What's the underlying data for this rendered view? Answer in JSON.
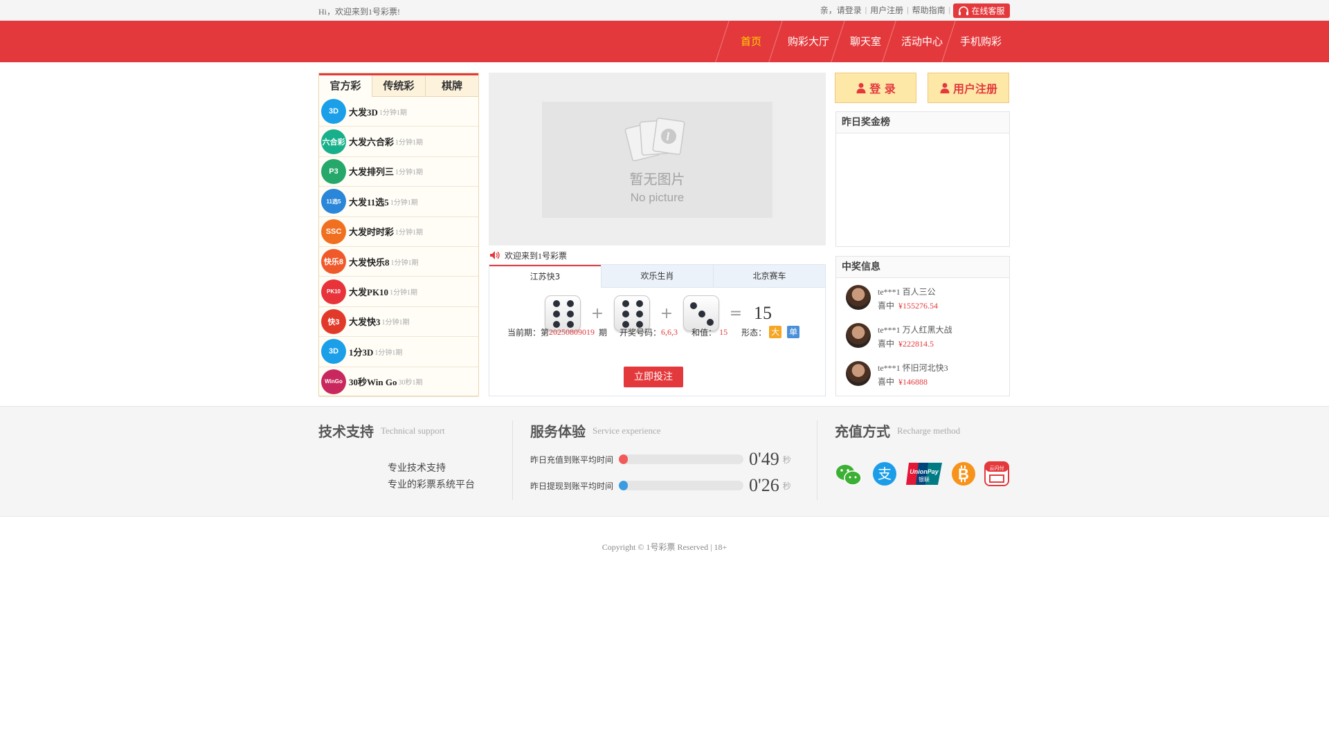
{
  "topbar": {
    "welcome": "Hi，欢迎来到1号彩票!",
    "login": "亲，请登录",
    "register": "用户注册",
    "help": "帮助指南",
    "separator": "|",
    "service": "在线客服"
  },
  "nav": {
    "items": [
      {
        "label": "首页",
        "active": true
      },
      {
        "label": "购彩大厅",
        "active": false
      },
      {
        "label": "聊天室",
        "active": false
      },
      {
        "label": "活动中心",
        "active": false
      },
      {
        "label": "手机购彩",
        "active": false
      }
    ]
  },
  "lottery": {
    "tabs": [
      "官方彩",
      "传统彩",
      "棋牌"
    ],
    "items": [
      {
        "name": "大发3D",
        "period": "1分钟1期",
        "icon_text": "3D",
        "color": "#1a9fe8"
      },
      {
        "name": "大发六合彩",
        "period": "1分钟1期",
        "icon_text": "六合彩",
        "color": "#17b08a"
      },
      {
        "name": "大发排列三",
        "period": "1分钟1期",
        "icon_text": "P3",
        "color": "#25a86a"
      },
      {
        "name": "大发11选5",
        "period": "1分钟1期",
        "icon_text": "11选5",
        "color": "#2a86d8"
      },
      {
        "name": "大发时时彩",
        "period": "1分钟1期",
        "icon_text": "SSC",
        "color": "#f07020"
      },
      {
        "name": "大发快乐8",
        "period": "1分钟1期",
        "icon_text": "快乐8",
        "color": "#f05a2a"
      },
      {
        "name": "大发PK10",
        "period": "1分钟1期",
        "icon_text": "PK10",
        "color": "#e8333a"
      },
      {
        "name": "大发快3",
        "period": "1分钟1期",
        "icon_text": "快3",
        "color": "#e23a2a"
      },
      {
        "name": "1分3D",
        "period": "1分钟1期",
        "icon_text": "3D",
        "color": "#1a9fe8"
      },
      {
        "name": "30秒Win Go",
        "period": "30秒1期",
        "icon_text": "WinGo",
        "color": "#c8285e"
      }
    ]
  },
  "banner": {
    "no_picture_cn": "暂无图片",
    "no_picture_en": "No picture"
  },
  "notice": "欢迎来到1号彩票",
  "draw": {
    "tabs": [
      {
        "label": "江苏快3",
        "active": true
      },
      {
        "label": "欢乐生肖",
        "active": false
      },
      {
        "label": "北京赛车",
        "active": false
      }
    ],
    "dice": [
      6,
      6,
      3
    ],
    "plus": "+",
    "equals": "=",
    "sum": "15",
    "period_label": "当前期：第",
    "period": "20250809019",
    "period_suffix": "期",
    "numbers_label": "开奖号码：",
    "numbers": "6,6,3",
    "sum_label": "和值：",
    "sum_value": "15",
    "shape_label": "形态：",
    "badge_big": "大",
    "badge_odd": "单",
    "badge_big_color": "#f5a623",
    "badge_odd_color": "#4a90d9",
    "bet_button": "立即投注"
  },
  "auth": {
    "login": "登 录",
    "register": "用户注册"
  },
  "prize": {
    "title": "昨日奖金榜"
  },
  "winners": {
    "title": "中奖信息",
    "won_label": "喜中",
    "list": [
      {
        "user": "te***1",
        "game": "百人三公",
        "amount": "¥155276.54"
      },
      {
        "user": "te***1",
        "game": "万人红黑大战",
        "amount": "¥222814.5"
      },
      {
        "user": "te***1",
        "game": "怀旧河北快3",
        "amount": "¥146888"
      }
    ]
  },
  "tech": {
    "title": "技术支持",
    "subtitle": "Technical support",
    "line1": "专业技术支持",
    "line2": "专业的彩票系统平台"
  },
  "service": {
    "title": "服务体验",
    "subtitle": "Service experience",
    "rows": [
      {
        "label": "昨日充值到账平均时间",
        "time": "0'49",
        "unit": "秒",
        "fill_fraction": 0.06,
        "color": "#f25a5a"
      },
      {
        "label": "昨日提现到账平均时间",
        "time": "0'26",
        "unit": "秒",
        "fill_fraction": 0.04,
        "color": "#3a9be0"
      }
    ]
  },
  "recharge": {
    "title": "充值方式",
    "subtitle": "Recharge method",
    "methods": [
      "wechat-icon",
      "alipay-icon",
      "unionpay-icon",
      "bitcoin-icon",
      "cloudpay-icon"
    ],
    "unionpay_text": "UnionPay",
    "unionpay_cn": "银联",
    "cloudpay_text": "云闪付"
  },
  "copyright": "Copyright © 1号彩票 Reserved | 18+",
  "colors": {
    "brand_red": "#e4393c",
    "nav_active": "#ffd200"
  }
}
